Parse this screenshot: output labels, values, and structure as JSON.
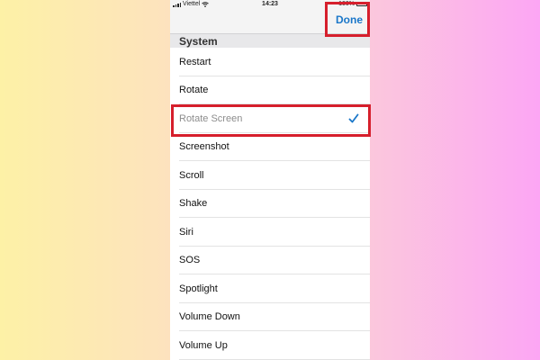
{
  "status_bar": {
    "carrier": "Viettel",
    "time": "14:23",
    "battery": "100%",
    "battery_level": 1.0,
    "icons": [
      "signal-icon",
      "wifi-icon",
      "battery-icon"
    ]
  },
  "nav": {
    "done_label": "Done",
    "accent_color": "#1a77c9"
  },
  "section": {
    "header": "System"
  },
  "items": [
    {
      "label": "Restart",
      "selected": false
    },
    {
      "label": "Rotate",
      "selected": false
    },
    {
      "label": "Rotate Screen",
      "selected": true
    },
    {
      "label": "Screenshot",
      "selected": false
    },
    {
      "label": "Scroll",
      "selected": false
    },
    {
      "label": "Shake",
      "selected": false
    },
    {
      "label": "Siri",
      "selected": false
    },
    {
      "label": "SOS",
      "selected": false
    },
    {
      "label": "Spotlight",
      "selected": false
    },
    {
      "label": "Volume Down",
      "selected": false
    },
    {
      "label": "Volume Up",
      "selected": false
    }
  ],
  "annotations": {
    "highlight_color": "#d61f2c",
    "highlighted_elements": [
      "done-button",
      "list-item-rotate-screen"
    ]
  }
}
